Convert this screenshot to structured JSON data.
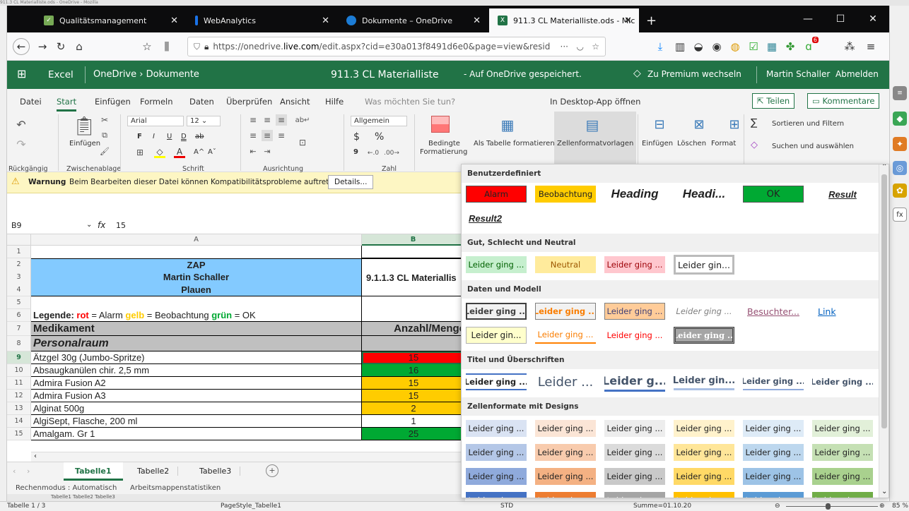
{
  "os_title": "911.3 CL Materialliste.ods - OneDrive - Mozilla",
  "browser": {
    "tabs": [
      {
        "label": "Qualitätsmanagement"
      },
      {
        "label": "WebAnalytics"
      },
      {
        "label": "Dokumente – OneDrive"
      },
      {
        "label": "911.3 CL Materialliste.ods - Mic"
      }
    ],
    "new_tab": "+",
    "url_prefix": "https://onedrive.",
    "url_domain": "live.com",
    "url_rest": "/edit.aspx?cid=e30a013f8491d6e0&page=view&resid",
    "url_more": "···",
    "ext_badge": "6"
  },
  "excel": {
    "app": "Excel",
    "crumb": "OneDrive › Dokumente",
    "doc_title": "911.3 CL Materialliste",
    "save_state": "-   Auf OneDrive gespeichert.",
    "premium": "Zu Premium wechseln",
    "user": "Martin Schaller",
    "signout": "Abmelden"
  },
  "menu": {
    "items": [
      "Datei",
      "Start",
      "Einfügen",
      "Formeln",
      "Daten",
      "Überprüfen",
      "Ansicht",
      "Hilfe"
    ],
    "tell_me": "Was möchten Sie tun?",
    "desktop": "In Desktop-App öffnen",
    "share": "Teilen",
    "comments": "Kommentare"
  },
  "ribbon": {
    "undo_group": "Rückgängig",
    "paste": "Einfügen",
    "clipboard_group": "Zwischenablage",
    "font_name": "Arial",
    "font_size": "12",
    "bold": "F",
    "italic": "I",
    "underline": "U",
    "dunder": "D",
    "strike": "ab",
    "grow": "A^",
    "shrink": "Aˇ",
    "font_group": "Schrift",
    "align_group": "Ausrichtung",
    "number_format": "Allgemein",
    "currency": "$",
    "percent": "%",
    "thousands": "9",
    "number_group": "Zahl",
    "cond_format": "Bedingte",
    "cond_format2": "Formatierung",
    "as_table": "Als Tabelle formatieren",
    "cell_styles": "Zellenformatvorlagen",
    "insert": "Einfügen",
    "delete": "Löschen",
    "format": "Format",
    "sigma": "∑",
    "sort_filter": "Sortieren und Filtern",
    "find_select": "Suchen und auswählen"
  },
  "warning": {
    "title": "Warnung",
    "text": "Beim Bearbeiten dieser Datei können Kompatibilitätsprobleme auftreten.",
    "details": "Details..."
  },
  "formula": {
    "cell_ref": "B9",
    "fx": "fx",
    "value": "15"
  },
  "grid": {
    "col_a": "A",
    "col_b": "B",
    "header_lines": [
      "ZAP",
      "Martin Schaller",
      "Plauen"
    ],
    "header_b": "9.1.1.3 CL Materiallis",
    "legend": {
      "prefix": "Legende: ",
      "rot": "rot",
      "t1": " = Alarm ",
      "gelb": "gelb",
      "t2": " = Beobachtung ",
      "gruen": "grün",
      "t3": " = OK"
    },
    "col_title_a": "Medikament",
    "col_title_b": "Anzahl/Menge",
    "section": "Personalraum",
    "rows": [
      {
        "n": "9",
        "a": "Ätzgel 30g (Jumbo-Spritze)",
        "b": "15",
        "color": "#ff0000"
      },
      {
        "n": "10",
        "a": "Absaugkanülen chir. 2,5 mm",
        "b": "16",
        "color": "#00a933"
      },
      {
        "n": "11",
        "a": "Admira Fusion A2",
        "b": "15",
        "color": "#ffcc00"
      },
      {
        "n": "12",
        "a": "Admira Fusion A3",
        "b": "15",
        "color": "#ffcc00"
      },
      {
        "n": "13",
        "a": "Alginat 500g",
        "b": "2",
        "color": "#ffcc00"
      },
      {
        "n": "14",
        "a": "AlgiSept, Flasche, 200 ml",
        "b": "1",
        "color": "#ffffff"
      },
      {
        "n": "15",
        "a": "Amalgam. Gr 1",
        "b": "25",
        "color": "#00a933"
      }
    ],
    "row_numbers": [
      "1",
      "2",
      "3",
      "4",
      "5",
      "6",
      "7",
      "8"
    ]
  },
  "sheets": {
    "tabs": [
      "Tabelle1",
      "Tabelle2",
      "Tabelle3"
    ],
    "add": "+"
  },
  "excel_status": {
    "calc": "Rechenmodus : Automatisch",
    "stats": "Arbeitsmappenstatistiken"
  },
  "lo_sheets": "Tabelle1  Tabelle2  Tabelle3",
  "lo_status": {
    "sheet": "Tabelle 1 / 3",
    "pagestyle": "PageStyle_Tabelle1",
    "std": "STD",
    "sum": "Summe=01.10.20",
    "zoom": "85 %"
  },
  "styles": {
    "sec_custom": "Benutzerdefiniert",
    "custom": [
      "Alarm",
      "Beobachtung",
      "Heading",
      "Headi...",
      "OK",
      "Result",
      "Result2"
    ],
    "sec_good": "Gut, Schlecht und Neutral",
    "good": [
      "Leider ging ...",
      "Neutral",
      "Leider ging ...",
      "Leider gin..."
    ],
    "sec_data": "Daten und Modell",
    "data1": [
      "Leider ging ...",
      "Leider ging ...",
      "Leider ging ...",
      "Leider ging ...",
      "Besuchter...",
      "Link"
    ],
    "data2": [
      "Leider gin...",
      "Leider ging ...",
      "Leider ging ...",
      "Leider ging ..."
    ],
    "sec_titles": "Titel und Überschriften",
    "titles": [
      "Leider ging ...",
      "Leider ...",
      "Leider g...",
      "Leider gin...",
      "Leider ging ...",
      "Leider ging ..."
    ],
    "sec_themes": "Zellenformate mit Designs",
    "theme_label": "Leider ging ...",
    "colors": {
      "alarm": "#ff0000",
      "beobachtung": "#ffcc00",
      "ok": "#00a933",
      "accent": "#217346"
    }
  }
}
